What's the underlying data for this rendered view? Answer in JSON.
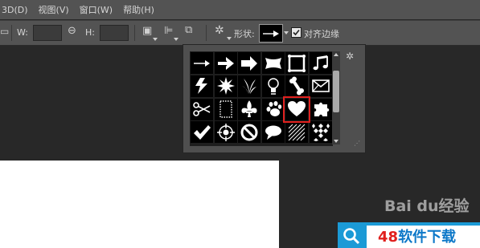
{
  "menu": [
    "3D(D)",
    "视图(V)",
    "窗口(W)",
    "帮助(H)"
  ],
  "options": {
    "w_label": "W:",
    "h_label": "H:",
    "shape_label": "形状:",
    "align_edges_label": "对齐边缘",
    "align_edges_checked": true
  },
  "shape_picker": {
    "shapes": [
      "arrow-thin-icon",
      "arrow-medium-icon",
      "arrow-bold-icon",
      "banner-icon",
      "frame-icon",
      "music-note-icon",
      "lightning-icon",
      "starburst-icon",
      "grass-icon",
      "lightbulb-icon",
      "bone-icon",
      "envelope-icon",
      "scissors-icon",
      "stamp-frame-icon",
      "fleur-de-lis-icon",
      "paw-icon",
      "heart-icon",
      "puzzle-icon",
      "checkmark-icon",
      "target-icon",
      "no-sign-icon",
      "speech-bubble-icon",
      "hatched-square-icon",
      "checkerboard-icon"
    ],
    "selected": "heart-icon"
  },
  "watermark": {
    "baidu": "Bai du经验",
    "site_prefix": "48",
    "site_suffix": "软件下载"
  }
}
